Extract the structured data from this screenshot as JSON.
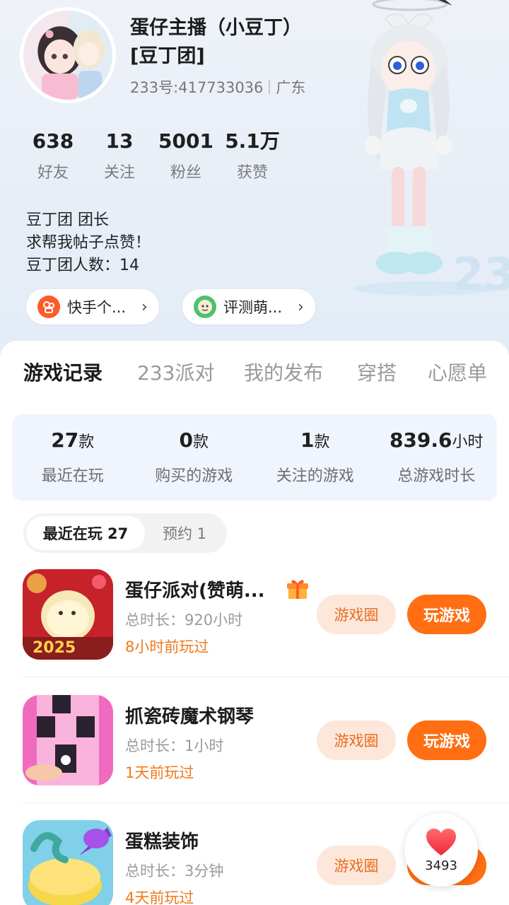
{
  "profile": {
    "name": "蛋仔主播（小豆丁）[豆丁团]",
    "id_text": "233号:417733036",
    "region": "广东"
  },
  "stats": [
    {
      "value": "638",
      "label": "好友"
    },
    {
      "value": "13",
      "label": "关注"
    },
    {
      "value": "5001",
      "label": "粉丝"
    },
    {
      "value": "5.1万",
      "label": "获赞"
    }
  ],
  "bio": [
    "豆丁团 团长",
    "求帮我帖子点赞！",
    "豆丁团人数：14"
  ],
  "chips": [
    {
      "label": "快手个...",
      "icon": "kuaishou-icon",
      "color": "#fe5a2a"
    },
    {
      "label": "评测萌...",
      "icon": "mascot-icon",
      "color": "#4cc26d"
    }
  ],
  "tabs": [
    "游戏记录",
    "233派对",
    "我的发布",
    "穿搭",
    "心愿单"
  ],
  "summary": [
    {
      "value": "27",
      "unit": "款",
      "label": "最近在玩"
    },
    {
      "value": "0",
      "unit": "款",
      "label": "购买的游戏"
    },
    {
      "value": "1",
      "unit": "款",
      "label": "关注的游戏"
    },
    {
      "value": "839.6",
      "unit": "小时",
      "label": "总游戏时长"
    }
  ],
  "segments": [
    {
      "label": "最近在玩 27"
    },
    {
      "label": "预约 1"
    }
  ],
  "games": [
    {
      "title": "蛋仔派对(赞萌...",
      "duration": "总时长：920小时",
      "last_played": "8小时前玩过",
      "has_gift": true
    },
    {
      "title": "抓瓷砖魔术钢琴",
      "duration": "总时长：1小时",
      "last_played": "1天前玩过",
      "has_gift": false
    },
    {
      "title": "蛋糕装饰",
      "duration": "总时长：3分钟",
      "last_played": "4天前玩过",
      "has_gift": false
    }
  ],
  "buttons": {
    "circle": "游戏圈",
    "play": "玩游戏"
  },
  "like": {
    "count": "3493"
  },
  "colors": {
    "accent": "#ff6e12",
    "accent_light": "#fde7da"
  }
}
